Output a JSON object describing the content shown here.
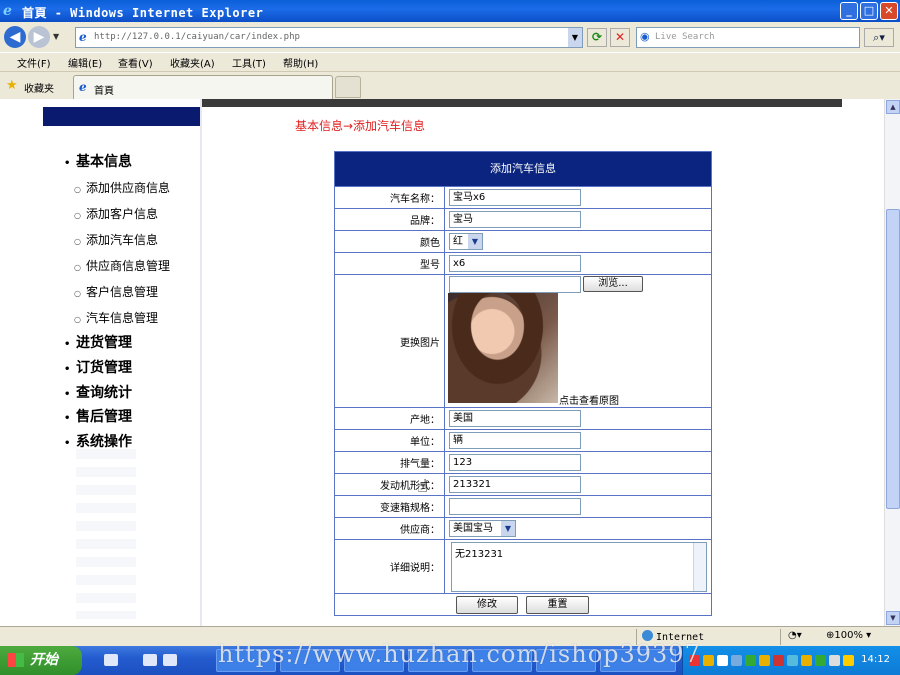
{
  "window": {
    "title": "首頁 - Windows Internet Explorer",
    "url": "http://127.0.0.1/caiyuan/car/index.php",
    "search_placeholder": "Live Search"
  },
  "menubar": [
    "文件(F)",
    "编辑(E)",
    "查看(V)",
    "收藏夹(A)",
    "工具(T)",
    "帮助(H)"
  ],
  "favorites": {
    "label": "收藏夹",
    "tab_title": "首頁"
  },
  "sidebar": {
    "sections": [
      {
        "label": "基本信息",
        "items": [
          "添加供应商信息",
          "添加客户信息",
          "添加汽车信息",
          "供应商信息管理",
          "客户信息管理",
          "汽车信息管理"
        ]
      },
      {
        "label": "进货管理"
      },
      {
        "label": "订货管理"
      },
      {
        "label": "查询统计"
      },
      {
        "label": "售后管理"
      },
      {
        "label": "系统操作"
      }
    ]
  },
  "breadcrumb": "基本信息→添加汽车信息",
  "form": {
    "title": "添加汽车信息",
    "fields": {
      "name": {
        "label": "汽车名称：",
        "value": "宝马x6"
      },
      "brand": {
        "label": "品牌：",
        "value": "宝马"
      },
      "color": {
        "label": "颜色",
        "value": "红"
      },
      "model": {
        "label": "型号",
        "value": "x6"
      },
      "image": {
        "label": "更换图片",
        "browse": "浏览...",
        "view_link": "点击查看原图"
      },
      "origin": {
        "label": "产地：",
        "value": "美国"
      },
      "unit": {
        "label": "单位：",
        "value": "辆"
      },
      "displacement": {
        "label": "排气量：",
        "value": "123"
      },
      "engine": {
        "label": "发动机形式：",
        "value": "213321"
      },
      "gearbox": {
        "label": "变速箱规格：",
        "value": ""
      },
      "supplier": {
        "label": "供应商：",
        "value": "美国宝马"
      },
      "description": {
        "label": "详细说明：",
        "value": "无213231"
      }
    },
    "submit": "修改",
    "reset": "重置"
  },
  "statusbar": {
    "zone": "Internet",
    "zoom": "100%"
  },
  "taskbar": {
    "start": "开始",
    "clock": "14:12"
  },
  "watermark": "https://www.huzhan.com/ishop39397"
}
